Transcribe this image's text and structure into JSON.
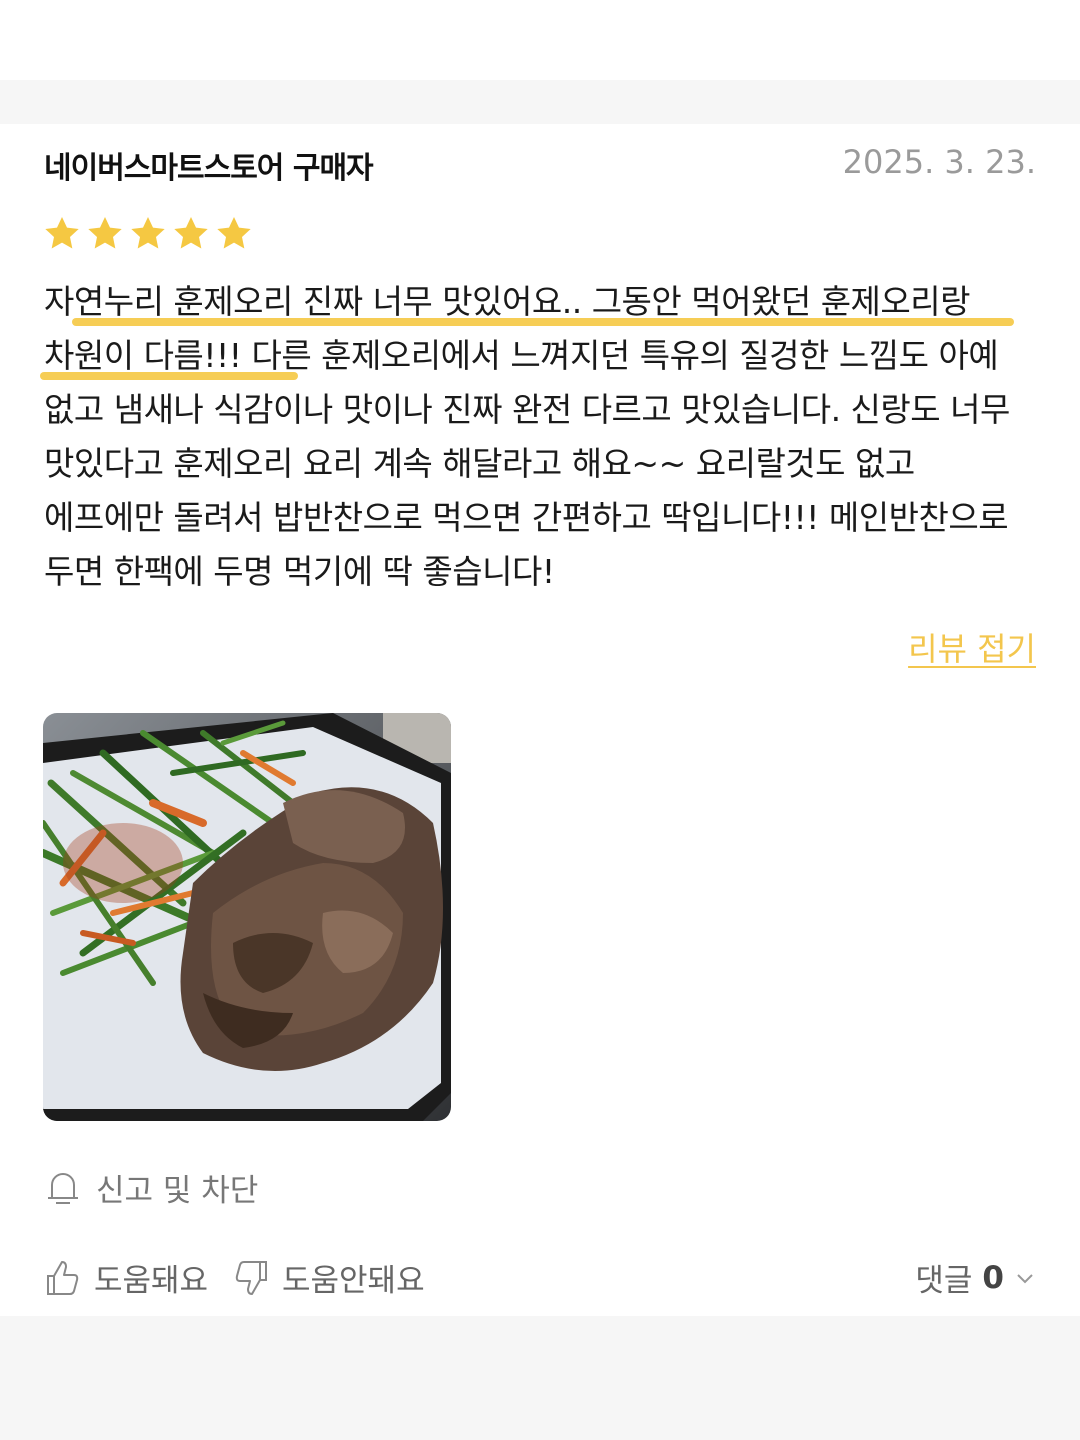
{
  "review": {
    "author": "네이버스마트스토어 구매자",
    "date": "2025. 3. 23.",
    "rating": 5,
    "rating_max": 5,
    "star_color": "#f5c842",
    "text": "자연누리 훈제오리 진짜 너무 맛있어요.. 그동안 먹어왔던 훈제오리랑 차원이 다름!!! 다른 훈제오리에서 느껴지던 특유의 질겅한 느낌도 아예 없고 냄새나 식감이나 맛이나 진짜 완전 다르고 맛있습니다. 신랑도 너무 맛있다고 훈제오리 요리 계속 해달라고 해요~~ 요리랄것도 없고 에프에만 돌려서 밥반찬으로 먹으면 간편하고 딱입니다!!! 메인반찬으로 두면 한팩에 두명 먹기에 딱 좋습니다!",
    "fold_label": "리뷰 접기",
    "accent_color": "#f3c64d",
    "photo_icon": "food-photo-smoked-duck"
  },
  "actions": {
    "report_label": "신고 및 차단",
    "report_icon": "bell-icon",
    "helpful_label": "도움돼요",
    "helpful_icon": "thumbs-up-icon",
    "not_helpful_label": "도움안돼요",
    "not_helpful_icon": "thumbs-down-icon",
    "comments_label": "댓글",
    "comments_count": "0",
    "comments_icon": "chevron-down-icon"
  }
}
